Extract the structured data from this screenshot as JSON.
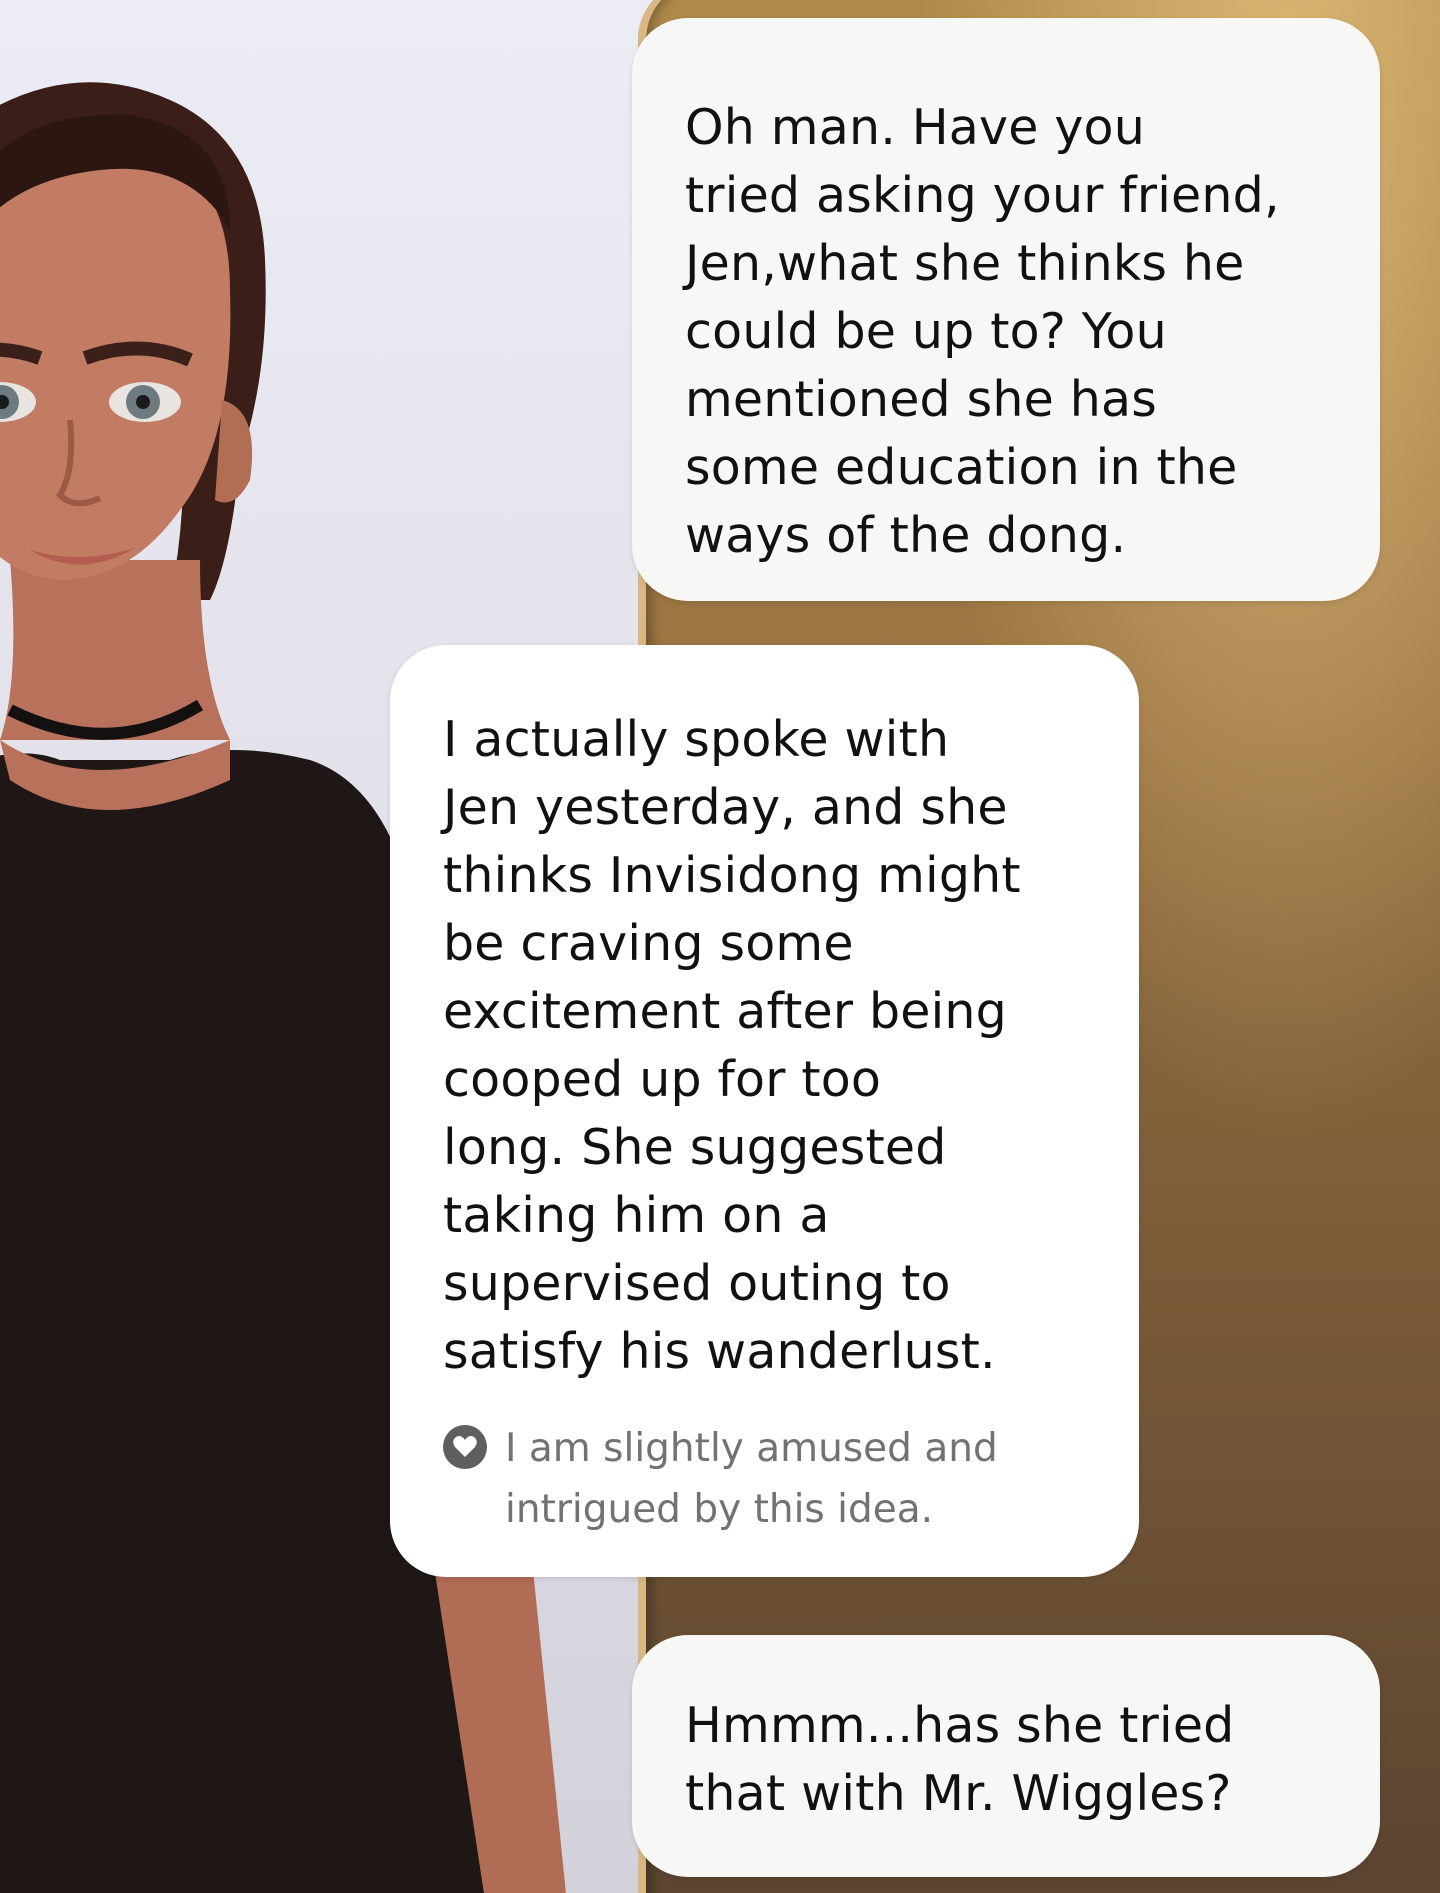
{
  "conversation": {
    "messages": [
      {
        "role": "user",
        "text": "Oh man.  Have you\ntried asking your friend,\nJen,what she thinks he\ncould be up to? You\nmentioned she has\nsome education in the\nways of the dong."
      },
      {
        "role": "assistant",
        "text": "I actually spoke with\nJen yesterday, and she\nthinks Invisidong might\nbe craving some\nexcitement after being\ncooped up for too\nlong. She suggested\ntaking him on a\nsupervised outing to\nsatisfy his wanderlust.",
        "emotion": {
          "icon": "heart-icon",
          "text": "I am slightly amused and\nintrigued by this idea."
        }
      },
      {
        "role": "user",
        "text": "Hmmm...has she tried\nthat with Mr. Wiggles?"
      }
    ]
  },
  "colors": {
    "bubble_bg": "#ffffff",
    "user_bubble_bg": "#f7f7f6",
    "text": "#111111",
    "emotion_text": "#727276",
    "door": "#9a7442"
  }
}
